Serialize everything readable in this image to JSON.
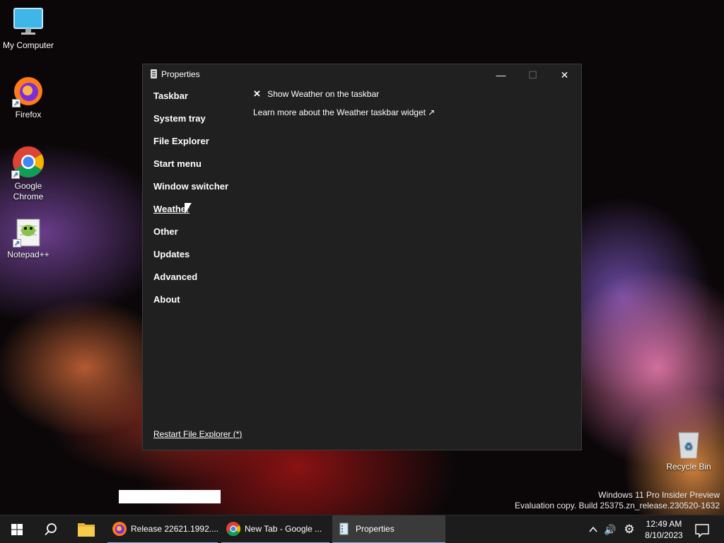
{
  "desktop": {
    "icons": [
      {
        "label": "My Computer",
        "icon": "monitor-icon"
      },
      {
        "label": "Firefox",
        "icon": "firefox-icon"
      },
      {
        "label": "Google Chrome",
        "icon": "chrome-icon"
      },
      {
        "label": "Notepad++",
        "icon": "notepadpp-icon"
      },
      {
        "label": "Recycle Bin",
        "icon": "recycle-bin-icon"
      }
    ],
    "watermark": {
      "line1": "Windows 11 Pro Insider Preview",
      "line2": "Evaluation copy. Build 25375.zn_release.230520-1632"
    }
  },
  "window": {
    "title": "Properties",
    "controls": {
      "minimize": "—",
      "maximize": "☐",
      "close": "✕"
    },
    "nav": [
      {
        "label": "Taskbar",
        "active": false
      },
      {
        "label": "System tray",
        "active": false
      },
      {
        "label": "File Explorer",
        "active": false
      },
      {
        "label": "Start menu",
        "active": false
      },
      {
        "label": "Window switcher",
        "active": false
      },
      {
        "label": "Weather",
        "active": true
      },
      {
        "label": "Other",
        "active": false
      },
      {
        "label": "Updates",
        "active": false
      },
      {
        "label": "Advanced",
        "active": false
      },
      {
        "label": "About",
        "active": false
      }
    ],
    "weather": {
      "show_option": {
        "mark": "✕",
        "label": "Show Weather on the taskbar"
      },
      "learn_more": "Learn more about the Weather taskbar widget ↗"
    },
    "restart_link": "Restart File Explorer (*)"
  },
  "taskbar": {
    "tasks": [
      {
        "label": "Release 22621.1992....",
        "icon": "firefox-icon"
      },
      {
        "label": "New Tab - Google ...",
        "icon": "chrome-icon"
      },
      {
        "label": "Properties",
        "icon": "properties-icon",
        "active": true
      }
    ],
    "tray": {
      "chevron": "^",
      "volume": "🔊",
      "settings": "⚙"
    },
    "clock": {
      "time": "12:49 AM",
      "date": "8/10/2023"
    },
    "colors": {
      "accent": "#86b4e9",
      "window_bg": "#202020",
      "taskbar_bg": "#1c1c1c"
    }
  }
}
